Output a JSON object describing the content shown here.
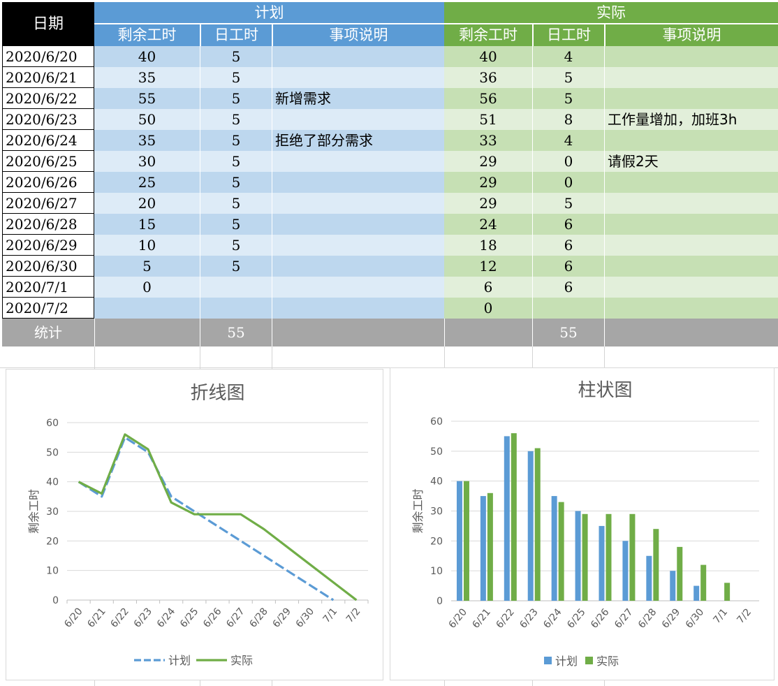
{
  "table": {
    "date_header": "日期",
    "plan_header": "计划",
    "actual_header": "实际",
    "sub_headers": [
      "剩余工时",
      "日工时",
      "事项说明"
    ],
    "rows": [
      {
        "date": "2020/6/20",
        "plan_rem": "40",
        "plan_day": "5",
        "plan_note": "",
        "act_rem": "40",
        "act_day": "4",
        "act_note": ""
      },
      {
        "date": "2020/6/21",
        "plan_rem": "35",
        "plan_day": "5",
        "plan_note": "",
        "act_rem": "36",
        "act_day": "5",
        "act_note": ""
      },
      {
        "date": "2020/6/22",
        "plan_rem": "55",
        "plan_day": "5",
        "plan_note": "新增需求",
        "act_rem": "56",
        "act_day": "5",
        "act_note": ""
      },
      {
        "date": "2020/6/23",
        "plan_rem": "50",
        "plan_day": "5",
        "plan_note": "",
        "act_rem": "51",
        "act_day": "8",
        "act_note": "工作量增加，加班3h"
      },
      {
        "date": "2020/6/24",
        "plan_rem": "35",
        "plan_day": "5",
        "plan_note": "拒绝了部分需求",
        "act_rem": "33",
        "act_day": "4",
        "act_note": ""
      },
      {
        "date": "2020/6/25",
        "plan_rem": "30",
        "plan_day": "5",
        "plan_note": "",
        "act_rem": "29",
        "act_day": "0",
        "act_note": "请假2天"
      },
      {
        "date": "2020/6/26",
        "plan_rem": "25",
        "plan_day": "5",
        "plan_note": "",
        "act_rem": "29",
        "act_day": "0",
        "act_note": ""
      },
      {
        "date": "2020/6/27",
        "plan_rem": "20",
        "plan_day": "5",
        "plan_note": "",
        "act_rem": "29",
        "act_day": "5",
        "act_note": ""
      },
      {
        "date": "2020/6/28",
        "plan_rem": "15",
        "plan_day": "5",
        "plan_note": "",
        "act_rem": "24",
        "act_day": "6",
        "act_note": ""
      },
      {
        "date": "2020/6/29",
        "plan_rem": "10",
        "plan_day": "5",
        "plan_note": "",
        "act_rem": "18",
        "act_day": "6",
        "act_note": ""
      },
      {
        "date": "2020/6/30",
        "plan_rem": "5",
        "plan_day": "5",
        "plan_note": "",
        "act_rem": "12",
        "act_day": "6",
        "act_note": ""
      },
      {
        "date": "2020/7/1",
        "plan_rem": "0",
        "plan_day": "",
        "plan_note": "",
        "act_rem": "6",
        "act_day": "6",
        "act_note": ""
      },
      {
        "date": "2020/7/2",
        "plan_rem": "",
        "plan_day": "",
        "plan_note": "",
        "act_rem": "0",
        "act_day": "",
        "act_note": ""
      }
    ],
    "total_label": "统计",
    "plan_total": "55",
    "act_total": "55"
  },
  "colors": {
    "plan_header": "#5b9bd5",
    "plan_dark": "#bdd7ee",
    "plan_light": "#ddebf7",
    "actual_header": "#70ad47",
    "actual_dark": "#c6e0b4",
    "actual_light": "#e2efda",
    "total": "#a6a6a6",
    "date_header": "#000000",
    "plan_series": "#5b9bd5",
    "actual_series": "#70ad47"
  },
  "chart_data": [
    {
      "type": "line",
      "title": "折线图",
      "ylabel": "剩余工时",
      "ylim": [
        0,
        60
      ],
      "yticks": [
        0,
        10,
        20,
        30,
        40,
        50,
        60
      ],
      "categories": [
        "6/20",
        "6/21",
        "6/22",
        "6/23",
        "6/24",
        "6/25",
        "6/26",
        "6/27",
        "6/28",
        "6/29",
        "6/30",
        "7/1",
        "7/2"
      ],
      "series": [
        {
          "name": "计划",
          "values": [
            40,
            35,
            55,
            50,
            35,
            30,
            25,
            20,
            15,
            10,
            5,
            0,
            null
          ]
        },
        {
          "name": "实际",
          "values": [
            40,
            36,
            56,
            51,
            33,
            29,
            29,
            29,
            24,
            18,
            12,
            6,
            0
          ]
        }
      ],
      "legend": "bottom",
      "grid": true
    },
    {
      "type": "bar",
      "title": "柱状图",
      "ylabel": "剩余工时",
      "ylim": [
        0,
        60
      ],
      "yticks": [
        0,
        10,
        20,
        30,
        40,
        50,
        60
      ],
      "categories": [
        "6/20",
        "6/21",
        "6/22",
        "6/23",
        "6/24",
        "6/25",
        "6/26",
        "6/27",
        "6/28",
        "6/29",
        "6/30",
        "7/1",
        "7/2"
      ],
      "series": [
        {
          "name": "计划",
          "values": [
            40,
            35,
            55,
            50,
            35,
            30,
            25,
            20,
            15,
            10,
            5,
            0,
            null
          ]
        },
        {
          "name": "实际",
          "values": [
            40,
            36,
            56,
            51,
            33,
            29,
            29,
            29,
            24,
            18,
            12,
            6,
            0
          ]
        }
      ],
      "legend": "bottom",
      "grid": true
    }
  ]
}
